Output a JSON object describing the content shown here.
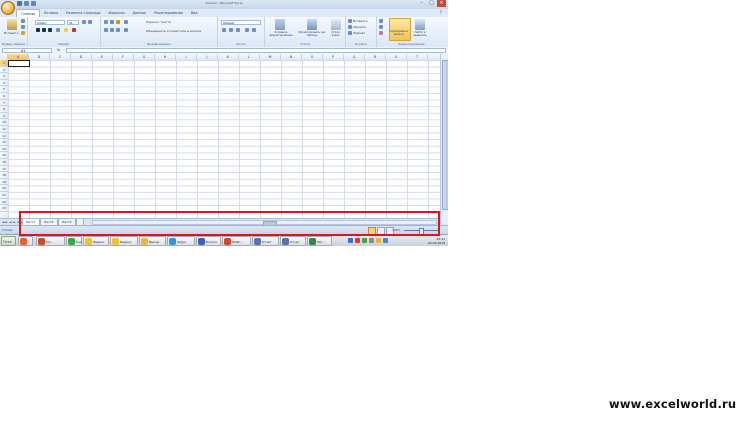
{
  "window": {
    "title": "Книга1 - Microsoft Excel",
    "controls": [
      "–",
      "□",
      "×"
    ]
  },
  "ribbon": {
    "tabs": [
      "Главная",
      "Вставка",
      "Разметка страницы",
      "Формулы",
      "Данные",
      "Рецензирование",
      "Вид"
    ],
    "active_tab": "Главная",
    "groups": {
      "clipboard": {
        "paste_label": "Вставить",
        "label": "Буфер обмена"
      },
      "font": {
        "font_name": "Calibri",
        "font_size": "11",
        "label": "Шрифт"
      },
      "alignment": {
        "wrap_label": "Перенос текста",
        "merge_label": "Объединить и поместить в центре",
        "label": "Выравнивание"
      },
      "number": {
        "format": "Общий",
        "label": "Число"
      },
      "styles": {
        "conditional_label": "Условное форматирование",
        "table_label": "Форматировать как таблицу",
        "cell_styles_label": "Стили ячеек",
        "label": "Стили"
      },
      "cells": {
        "insert_label": "Вставить",
        "delete_label": "Удалить",
        "format_label": "Формат",
        "label": "Ячейки"
      },
      "editing": {
        "sort_label": "Сортировка и фильтр",
        "find_label": "Найти и выделить",
        "label": "Редактирование"
      }
    }
  },
  "formula_bar": {
    "name_box": "A1",
    "fx": "fx",
    "value": ""
  },
  "grid": {
    "columns": [
      "A",
      "B",
      "C",
      "D",
      "E",
      "F",
      "G",
      "H",
      "I",
      "J",
      "K",
      "L",
      "M",
      "N",
      "O",
      "P",
      "Q",
      "R",
      "S",
      "T"
    ],
    "rows": [
      "1",
      "2",
      "3",
      "4",
      "5",
      "6",
      "7",
      "8",
      "9",
      "10",
      "11",
      "12",
      "13",
      "14",
      "15",
      "16",
      "17",
      "18",
      "19",
      "20",
      "21",
      "22",
      "23"
    ],
    "selected_cell": "A1"
  },
  "sheets": {
    "nav": "◄◄ ◄ ► ►►",
    "tabs": [
      "Лист1",
      "Лист2",
      "Лист3"
    ],
    "active": "Лист1"
  },
  "status": {
    "text": "Готово",
    "zoom": "100%"
  },
  "taskbar": {
    "start_label": "Пуск",
    "items": [
      {
        "label": "Int...",
        "color": "#d6452b"
      },
      {
        "label": "Скачать",
        "color": "#3aa84a"
      },
      {
        "label": "Яндекс",
        "color": "#f2c02d"
      },
      {
        "label": "Яндекс",
        "color": "#f2c02d"
      },
      {
        "label": "Выход",
        "color": "#f5b335"
      },
      {
        "label": "Skype",
        "color": "#2a9ae0"
      },
      {
        "label": "Болото",
        "color": "#3c5fb8"
      },
      {
        "label": "UDW...",
        "color": "#d9412f"
      },
      {
        "label": "Отчет",
        "color": "#5573b3"
      },
      {
        "label": "Отчет",
        "color": "#5573b3"
      },
      {
        "label": "Mic...",
        "color": "#2f8a3b"
      }
    ],
    "clock_time": "15:11",
    "clock_date": "02.03.2013"
  },
  "watermark": "www.excelworld.ru"
}
